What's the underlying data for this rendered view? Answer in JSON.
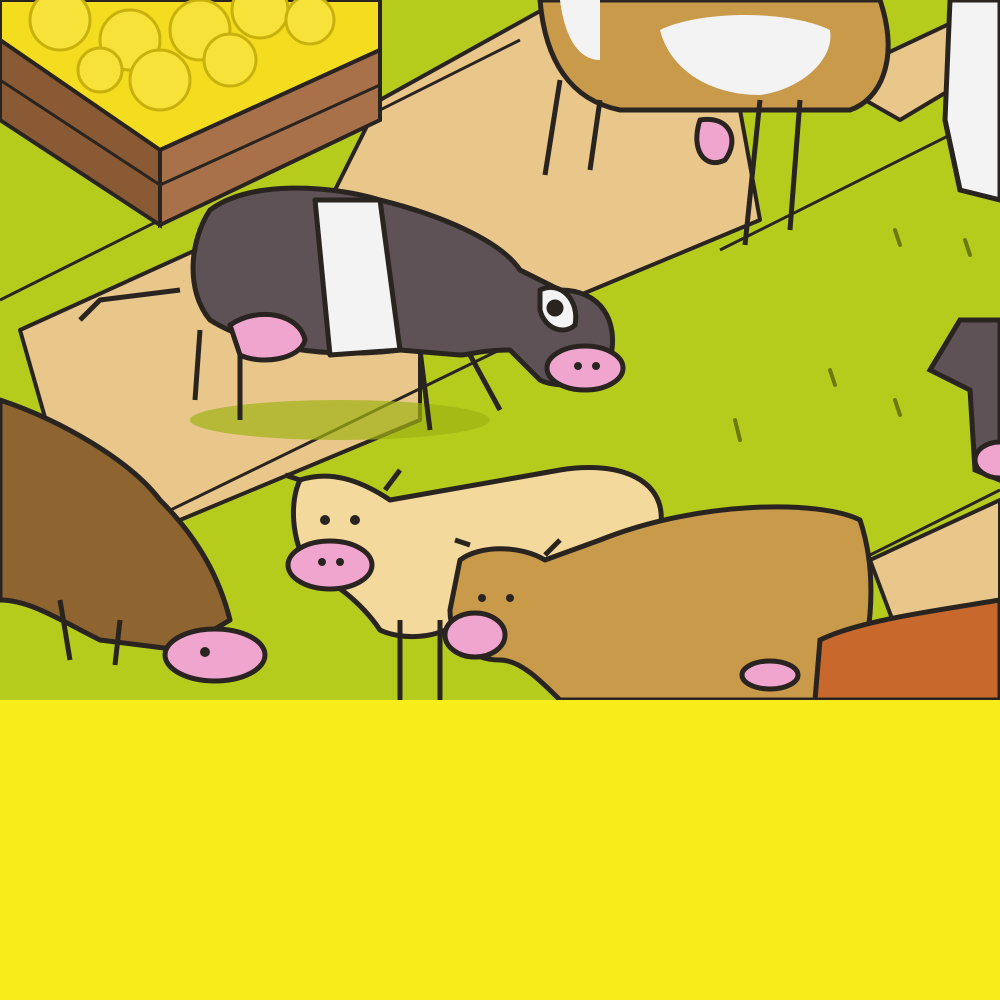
{
  "colors": {
    "grass": "#b6cc1d",
    "grass_shade": "#9fb214",
    "dirt": "#e9c78a",
    "dirt_dark": "#c9a469",
    "outline": "#2a2420",
    "crate_wood": "#8a5a35",
    "crate_wood_light": "#a9714a",
    "lemon": "#f4dc1e",
    "cow_dark": "#5e5256",
    "cow_white": "#f3f3f3",
    "cow_brown": "#8e6430",
    "cow_tan": "#c89a4a",
    "cow_cream": "#f4d99c",
    "cow_orange": "#c8682c",
    "nose_pink": "#f0a5cf",
    "bottom_panel": "#f8ec1a"
  },
  "scene": {
    "crate": {
      "icon": "lemon-crate-icon",
      "contents": "lemons"
    },
    "animals": [
      {
        "name": "cow-belted-dark",
        "icon": "cow-icon"
      },
      {
        "name": "cow-brown-grazing",
        "icon": "cow-icon"
      },
      {
        "name": "cow-cream",
        "icon": "cow-icon"
      },
      {
        "name": "cow-tan",
        "icon": "cow-icon"
      },
      {
        "name": "cow-top-patched",
        "icon": "cow-icon"
      },
      {
        "name": "cow-right-edge",
        "icon": "cow-icon"
      },
      {
        "name": "cow-orange-partial",
        "icon": "cow-icon"
      }
    ]
  }
}
